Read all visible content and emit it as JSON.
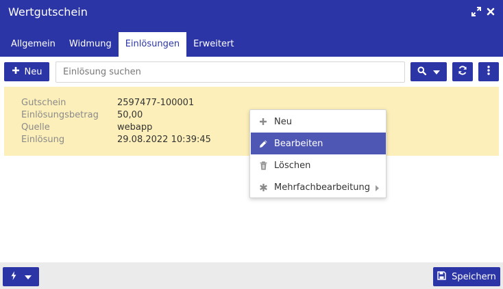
{
  "window": {
    "title": "Wertgutschein"
  },
  "tabs": [
    {
      "label": "Allgemein",
      "active": false
    },
    {
      "label": "Widmung",
      "active": false
    },
    {
      "label": "Einlösungen",
      "active": true
    },
    {
      "label": "Erweitert",
      "active": false
    }
  ],
  "toolbar": {
    "new_label": "Neu",
    "search_placeholder": "Einlösung suchen",
    "search_value": ""
  },
  "record": {
    "fields": [
      {
        "label": "Gutschein",
        "value": "2597477-100001"
      },
      {
        "label": "Einlösungsbetrag",
        "value": "50,00"
      },
      {
        "label": "Quelle",
        "value": "webapp"
      },
      {
        "label": "Einlösung",
        "value": "29.08.2022 10:39:45"
      }
    ]
  },
  "context_menu": {
    "items": [
      {
        "label": "Neu",
        "icon": "plus-icon",
        "highlighted": false
      },
      {
        "label": "Bearbeiten",
        "icon": "pencil-icon",
        "highlighted": true
      },
      {
        "label": "Löschen",
        "icon": "trash-icon",
        "highlighted": false
      },
      {
        "label": "Mehrfachbearbeitung",
        "icon": "asterisk-icon",
        "highlighted": false,
        "has_submenu": true
      }
    ]
  },
  "footer": {
    "save_label": "Speichern"
  },
  "colors": {
    "primary": "#2b35a6",
    "record_highlight": "#fcefb9",
    "menu_highlight": "#4f57b4",
    "footer_bg": "#ebebeb"
  }
}
